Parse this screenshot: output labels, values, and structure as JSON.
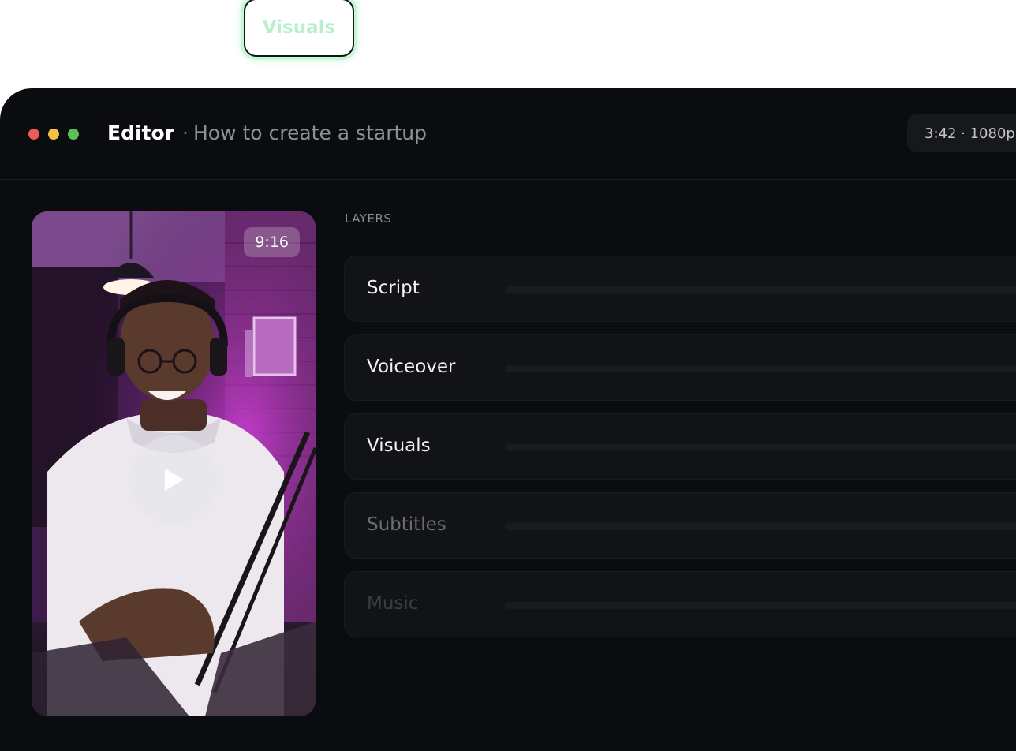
{
  "top_chip": {
    "label": "Visuals"
  },
  "window": {
    "title": "Editor",
    "separator": "·",
    "project": "How to create a startup",
    "meta": "3:42 · 1080p"
  },
  "preview": {
    "aspect_ratio": "9:16"
  },
  "layers": {
    "heading": "LAYERS",
    "items": [
      {
        "label": "Script",
        "color": "#f1f1f3"
      },
      {
        "label": "Voiceover",
        "color": "#f1f1f3"
      },
      {
        "label": "Visuals",
        "color": "#f1f1f3"
      },
      {
        "label": "Subtitles",
        "color": "#6b6d73"
      },
      {
        "label": "Music",
        "color": "#3b3d42"
      }
    ]
  }
}
